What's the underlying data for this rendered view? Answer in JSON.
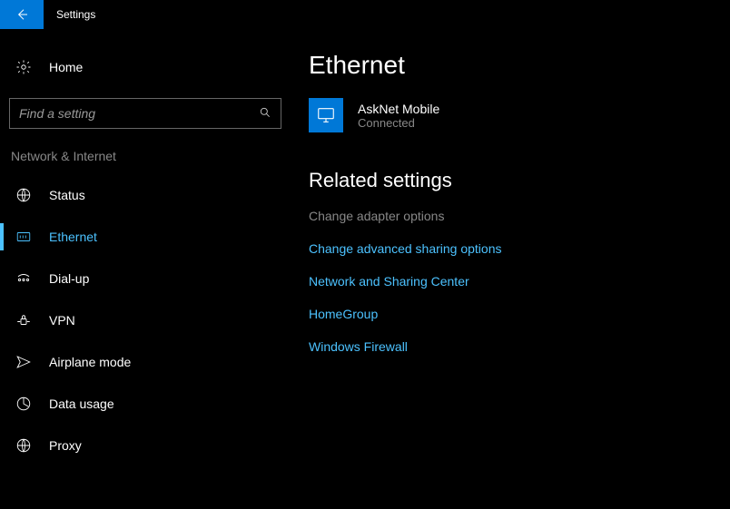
{
  "window": {
    "title": "Settings"
  },
  "sidebar": {
    "home_label": "Home",
    "search_placeholder": "Find a setting",
    "category": "Network & Internet",
    "items": [
      {
        "label": "Status"
      },
      {
        "label": "Ethernet"
      },
      {
        "label": "Dial-up"
      },
      {
        "label": "VPN"
      },
      {
        "label": "Airplane mode"
      },
      {
        "label": "Data usage"
      },
      {
        "label": "Proxy"
      }
    ]
  },
  "main": {
    "title": "Ethernet",
    "network": {
      "name": "AskNet Mobile",
      "status": "Connected"
    },
    "related_title": "Related settings",
    "related": [
      {
        "label": "Change adapter options",
        "disabled": true
      },
      {
        "label": "Change advanced sharing options",
        "disabled": false
      },
      {
        "label": "Network and Sharing Center",
        "disabled": false
      },
      {
        "label": "HomeGroup",
        "disabled": false
      },
      {
        "label": "Windows Firewall",
        "disabled": false
      }
    ]
  }
}
